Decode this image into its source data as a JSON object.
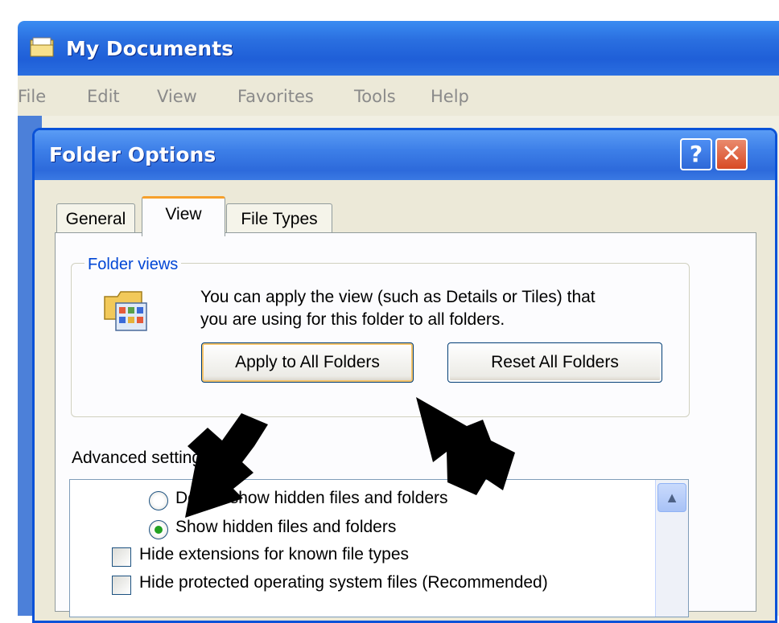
{
  "outer_window": {
    "title": "My Documents",
    "menu": [
      "File",
      "Edit",
      "View",
      "Favorites",
      "Tools",
      "Help"
    ]
  },
  "dialog": {
    "title": "Folder Options",
    "help_label": "?",
    "close_label": "✕",
    "tabs": [
      {
        "label": "General",
        "active": false
      },
      {
        "label": "View",
        "active": true
      },
      {
        "label": "File Types",
        "active": false
      }
    ],
    "folder_views": {
      "group_title": "Folder views",
      "description_line1": "You can apply the view (such as Details or Tiles) that",
      "description_line2": "you are using for this folder to all folders.",
      "apply_button": "Apply to All Folders",
      "reset_button": "Reset All Folders"
    },
    "advanced": {
      "label": "Advanced settings:",
      "items": [
        {
          "type": "radio",
          "label": "Do not show hidden files and folders",
          "checked": false
        },
        {
          "type": "radio",
          "label": "Show hidden files and folders",
          "checked": true
        },
        {
          "type": "checkbox",
          "label": "Hide extensions for known file types",
          "checked": false
        },
        {
          "type": "checkbox",
          "label": "Hide protected operating system files (Recommended)",
          "checked": false
        }
      ]
    }
  },
  "icons": {
    "title_icon": "folder-window-icon",
    "folder_icon": "folder-views-icon",
    "scroll_up": "chevron-up-icon"
  },
  "colors": {
    "titlebar": "#2a6fe0",
    "close": "#d84a24",
    "group_title": "#0046d5",
    "active_tab": "#f6a02c"
  }
}
